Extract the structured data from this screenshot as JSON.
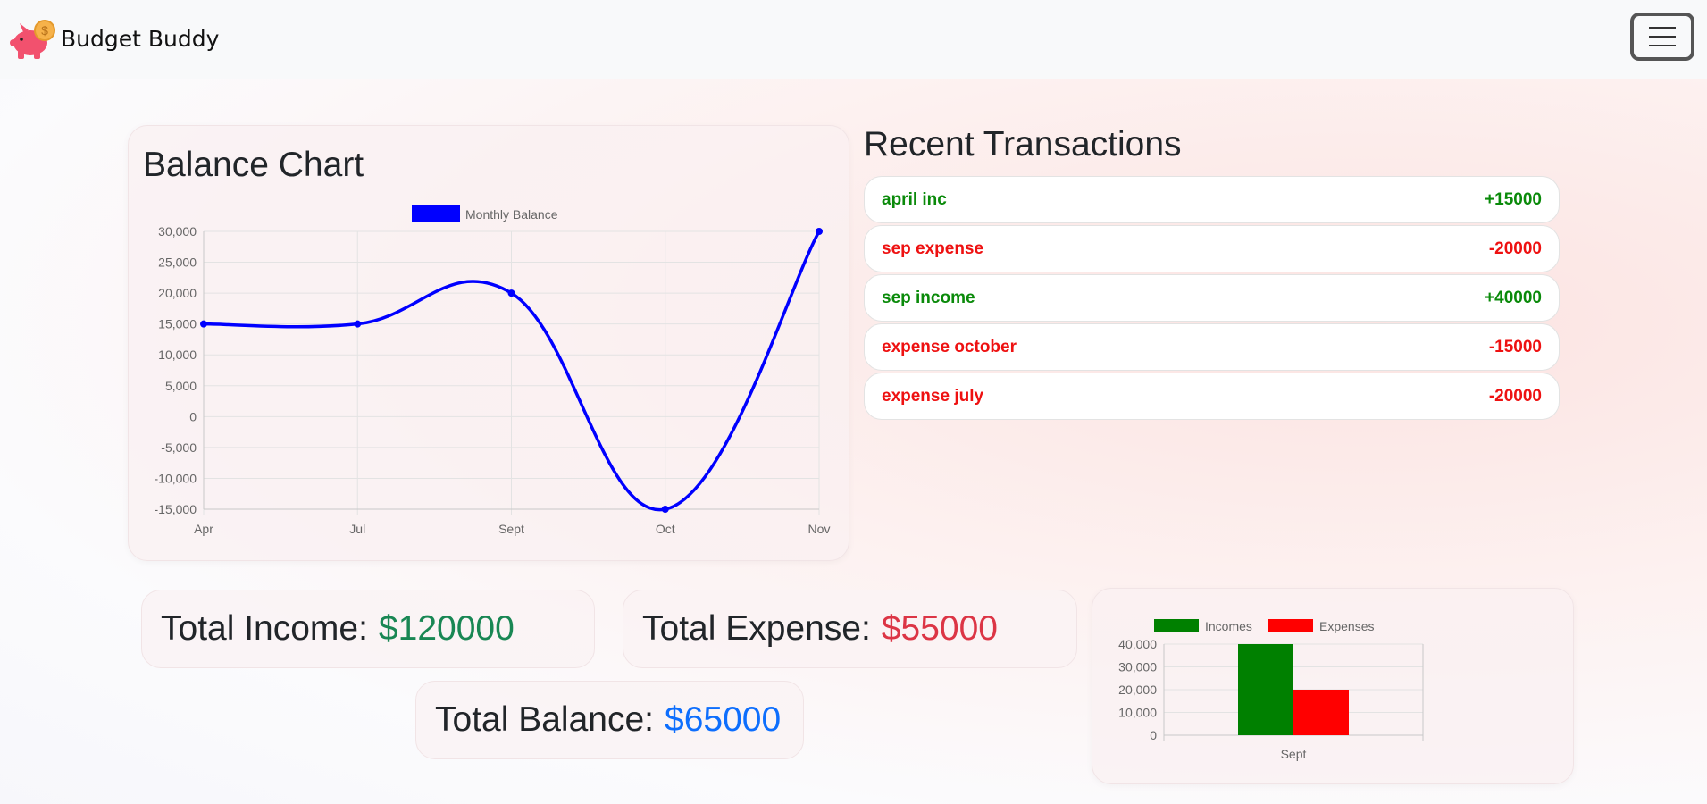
{
  "brand": {
    "name": "Budget Buddy"
  },
  "balance_section": {
    "title": "Balance Chart"
  },
  "transactions": {
    "title": "Recent Transactions",
    "items": [
      {
        "name": "april inc",
        "amount": "+15000",
        "type": "income"
      },
      {
        "name": "sep expense",
        "amount": "-20000",
        "type": "expense"
      },
      {
        "name": "sep income",
        "amount": "+40000",
        "type": "income"
      },
      {
        "name": "expense october",
        "amount": "-15000",
        "type": "expense"
      },
      {
        "name": "expense july",
        "amount": "-20000",
        "type": "expense"
      }
    ]
  },
  "totals": {
    "income_label": "Total Income:",
    "income_value": "$120000",
    "expense_label": "Total Expense:",
    "expense_value": "$55000",
    "balance_label": "Total Balance:",
    "balance_value": "$65000"
  },
  "colors": {
    "income": "#198754",
    "expense": "#dc3545",
    "balance": "#0d6efd",
    "line": "#0000ff",
    "bar_income": "#008000",
    "bar_expense": "#ff0000"
  },
  "chart_data": [
    {
      "type": "line",
      "categories": [
        "Apr",
        "Jul",
        "Sept",
        "Oct",
        "Nov"
      ],
      "series": [
        {
          "name": "Monthly Balance",
          "values": [
            15000,
            15000,
            20000,
            -15000,
            30000
          ]
        }
      ],
      "ylim": [
        -15000,
        30000
      ],
      "yticks": [
        "30,000",
        "25,000",
        "20,000",
        "15,000",
        "10,000",
        "5,000",
        "0",
        "-5,000",
        "-10,000",
        "-15,000"
      ],
      "grid": true,
      "legend": "top"
    },
    {
      "type": "bar",
      "categories": [
        "Sept"
      ],
      "series": [
        {
          "name": "Incomes",
          "values": [
            40000
          ]
        },
        {
          "name": "Expenses",
          "values": [
            20000
          ]
        }
      ],
      "ylim": [
        0,
        40000
      ],
      "yticks": [
        "40,000",
        "30,000",
        "20,000",
        "10,000",
        "0"
      ],
      "grid": true,
      "legend": "top"
    }
  ]
}
